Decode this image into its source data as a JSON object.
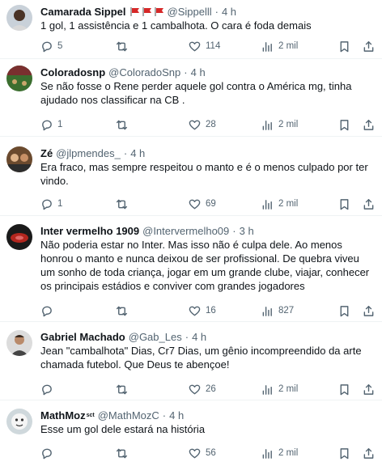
{
  "tweets": [
    {
      "name": "Camarada Sippel",
      "handle": "@Sippelll",
      "time": "4 h",
      "has_flags": true,
      "text": "1 gol, 1 assistência e 1 cambalhota. O cara é foda demais",
      "replies": "5",
      "retweets": "",
      "likes": "114",
      "views": "2 mil"
    },
    {
      "name": "Coloradosnp",
      "handle": "@ColoradoSnp",
      "time": "4 h",
      "text": "Se não fosse o Rene perder aquele gol contra o América mg, tinha ajudado nos classificar na CB .",
      "replies": "1",
      "retweets": "",
      "likes": "28",
      "views": "2 mil"
    },
    {
      "name": "Zé",
      "handle": "@jlpmendes_",
      "time": "4 h",
      "text": "Era fraco, mas sempre respeitou o manto e é o menos culpado por ter vindo.",
      "replies": "1",
      "retweets": "",
      "likes": "69",
      "views": "2 mil"
    },
    {
      "name": "Inter vermelho 1909",
      "handle": "@Intervermelho09",
      "time": "3 h",
      "text": "Não poderia estar no Inter. Mas isso não é culpa dele. Ao menos honrou o manto e nunca deixou de ser profissional.  De quebra viveu um sonho de toda criança,  jogar em um grande clube, viajar, conhecer os principais estádios e conviver com grandes jogadores",
      "replies": "",
      "retweets": "",
      "likes": "16",
      "views": "827"
    },
    {
      "name": "Gabriel Machado",
      "handle": "@Gab_Les",
      "time": "4 h",
      "text": "Jean \"cambalhota\" Dias, Cr7 Dias, um gênio incompreendido da arte chamada futebol. Que Deus te abençoe!",
      "replies": "",
      "retweets": "",
      "likes": "26",
      "views": "2 mil"
    },
    {
      "name": "MathMoz",
      "name_sup": "sct",
      "handle": "@MathMozC",
      "time": "4 h",
      "text": "Esse um gol dele estará na história",
      "replies": "",
      "retweets": "",
      "likes": "56",
      "views": "2 mil"
    }
  ],
  "dot": "·",
  "colors": {
    "text": "#0f1419",
    "secondary": "#536471",
    "divider": "#eff3f4",
    "flag_red": "#d62828"
  }
}
